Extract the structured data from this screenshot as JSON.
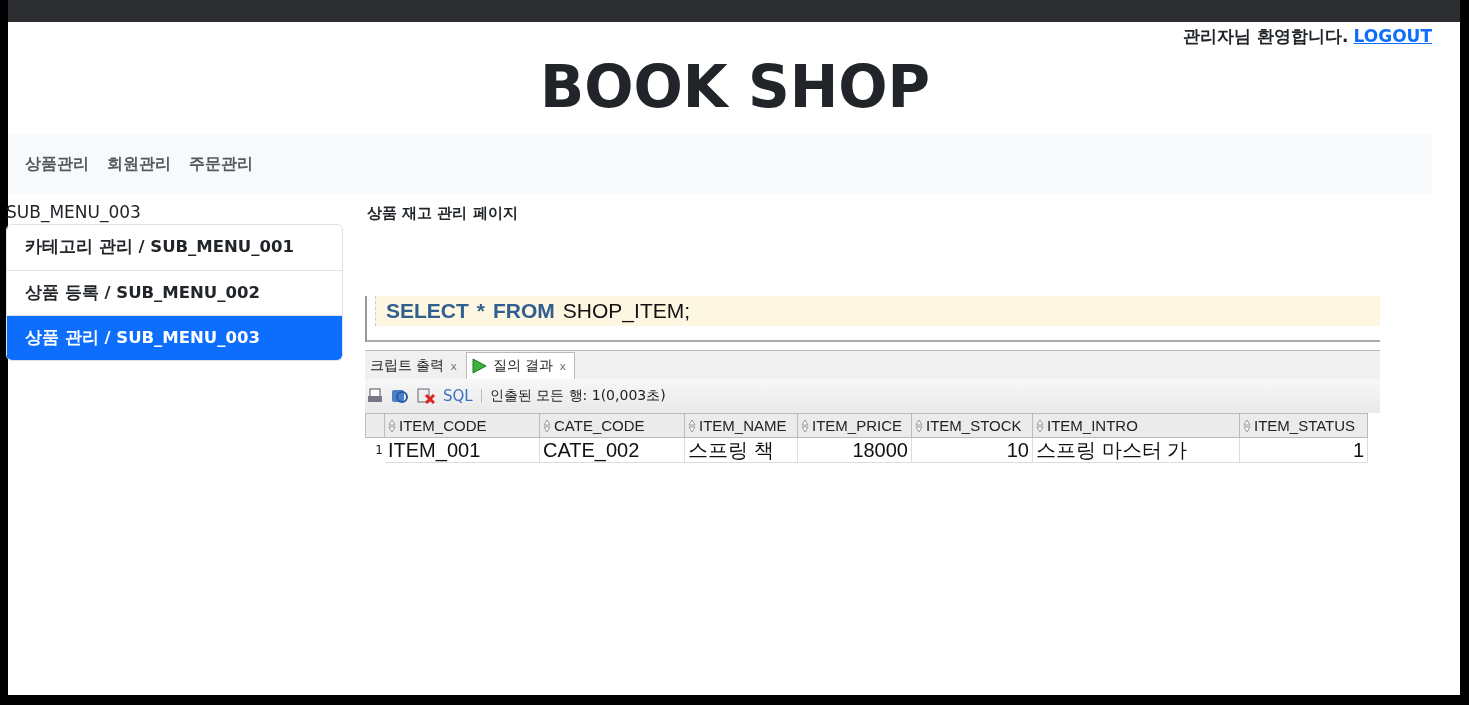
{
  "header": {
    "welcome": "관리자님 환영합니다.",
    "logout": "LOGOUT"
  },
  "title": "BOOK SHOP",
  "nav": {
    "items": [
      "상품관리",
      "회원관리",
      "주문관리"
    ]
  },
  "sidebar": {
    "heading": "SUB_MENU_003",
    "items": [
      {
        "label": "카테고리 관리 / SUB_MENU_001",
        "selected": false
      },
      {
        "label": "상품 등록 / SUB_MENU_002",
        "selected": false
      },
      {
        "label": "상품 관리 / SUB_MENU_003",
        "selected": true
      }
    ]
  },
  "main": {
    "heading": "상품 재고 관리 페이지",
    "query": {
      "sql": [
        {
          "text": "SELECT",
          "kind": "keyword"
        },
        {
          "text": "*",
          "kind": "operator"
        },
        {
          "text": "FROM",
          "kind": "keyword"
        },
        {
          "text": "SHOP_ITEM;",
          "kind": "plain"
        }
      ],
      "tabs": [
        {
          "label": "크립트 출력",
          "close": "x",
          "selected": false
        },
        {
          "label": "질의 결과",
          "close": "x",
          "selected": true
        }
      ],
      "toolbar": {
        "sql": "SQL",
        "status": "인출된 모든 행: 1(0,003초)"
      },
      "columns": [
        {
          "name": "ITEM_CODE",
          "kind": "text"
        },
        {
          "name": "CATE_CODE",
          "kind": "text"
        },
        {
          "name": "ITEM_NAME",
          "kind": "text"
        },
        {
          "name": "ITEM_PRICE",
          "kind": "number"
        },
        {
          "name": "ITEM_STOCK",
          "kind": "number"
        },
        {
          "name": "ITEM_INTRO",
          "kind": "text"
        },
        {
          "name": "ITEM_STATUS",
          "kind": "number"
        }
      ],
      "rows": [
        {
          "number": "1",
          "cells": [
            "ITEM_001",
            "CATE_002",
            "스프링 책",
            "18000",
            "10",
            "스프링 마스터 가",
            "1"
          ]
        }
      ]
    }
  }
}
